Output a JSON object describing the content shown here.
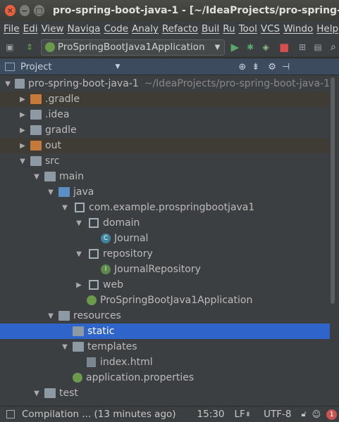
{
  "window": {
    "title": "pro-spring-boot-java-1 - [~/IdeaProjects/pro-spring-boot"
  },
  "menu": [
    "File",
    "Edi",
    "View",
    "Naviga",
    "Code",
    "Analy",
    "Refacto",
    "Buil",
    "Ru",
    "Tool",
    "VCS",
    "Windo",
    "Help"
  ],
  "toolbar": {
    "run_config": "ProSpringBootJava1Application"
  },
  "project_panel": {
    "title": "Project"
  },
  "tree": [
    {
      "label": "pro-spring-boot-java-1",
      "muted": "~/IdeaProjects/pro-spring-boot-java-1",
      "depth": 0,
      "toggle": "down",
      "icon": "folder",
      "state": ""
    },
    {
      "label": ".gradle",
      "depth": 1,
      "toggle": "right",
      "icon": "folder-orange",
      "state": "excluded"
    },
    {
      "label": ".idea",
      "depth": 1,
      "toggle": "right",
      "icon": "folder",
      "state": ""
    },
    {
      "label": "gradle",
      "depth": 1,
      "toggle": "right",
      "icon": "folder",
      "state": ""
    },
    {
      "label": "out",
      "depth": 1,
      "toggle": "right",
      "icon": "folder-orange",
      "state": "excluded"
    },
    {
      "label": "src",
      "depth": 1,
      "toggle": "down",
      "icon": "folder",
      "state": ""
    },
    {
      "label": "main",
      "depth": 2,
      "toggle": "down",
      "icon": "folder",
      "state": ""
    },
    {
      "label": "java",
      "depth": 3,
      "toggle": "down",
      "icon": "folder-blue",
      "state": ""
    },
    {
      "label": "com.example.prospringbootjava1",
      "depth": 4,
      "toggle": "down",
      "icon": "package",
      "state": ""
    },
    {
      "label": "domain",
      "depth": 5,
      "toggle": "down",
      "icon": "package",
      "state": ""
    },
    {
      "label": "Journal",
      "depth": 6,
      "toggle": "",
      "icon": "class",
      "state": ""
    },
    {
      "label": "repository",
      "depth": 5,
      "toggle": "down",
      "icon": "package",
      "state": ""
    },
    {
      "label": "JournalRepository",
      "depth": 6,
      "toggle": "",
      "icon": "interface",
      "state": ""
    },
    {
      "label": "web",
      "depth": 5,
      "toggle": "right",
      "icon": "package",
      "state": ""
    },
    {
      "label": "ProSpringBootJava1Application",
      "depth": 5,
      "toggle": "",
      "icon": "spring",
      "state": ""
    },
    {
      "label": "resources",
      "depth": 3,
      "toggle": "down",
      "icon": "folder",
      "state": ""
    },
    {
      "label": "static",
      "depth": 4,
      "toggle": "",
      "icon": "folder",
      "state": "selected"
    },
    {
      "label": "templates",
      "depth": 4,
      "toggle": "down",
      "icon": "folder",
      "state": ""
    },
    {
      "label": "index.html",
      "depth": 5,
      "toggle": "",
      "icon": "html",
      "state": ""
    },
    {
      "label": "application.properties",
      "depth": 4,
      "toggle": "",
      "icon": "spring",
      "state": ""
    },
    {
      "label": "test",
      "depth": 2,
      "toggle": "down",
      "icon": "folder",
      "state": ""
    }
  ],
  "status": {
    "message": "Compilation ... (13 minutes ago)",
    "time": "15:30",
    "line_sep": "LF",
    "encoding": "UTF-8",
    "notifications": "1"
  },
  "colors": {
    "selection": "#2f65ca",
    "excluded": "#3f3c36",
    "accent": "#e9603c"
  }
}
